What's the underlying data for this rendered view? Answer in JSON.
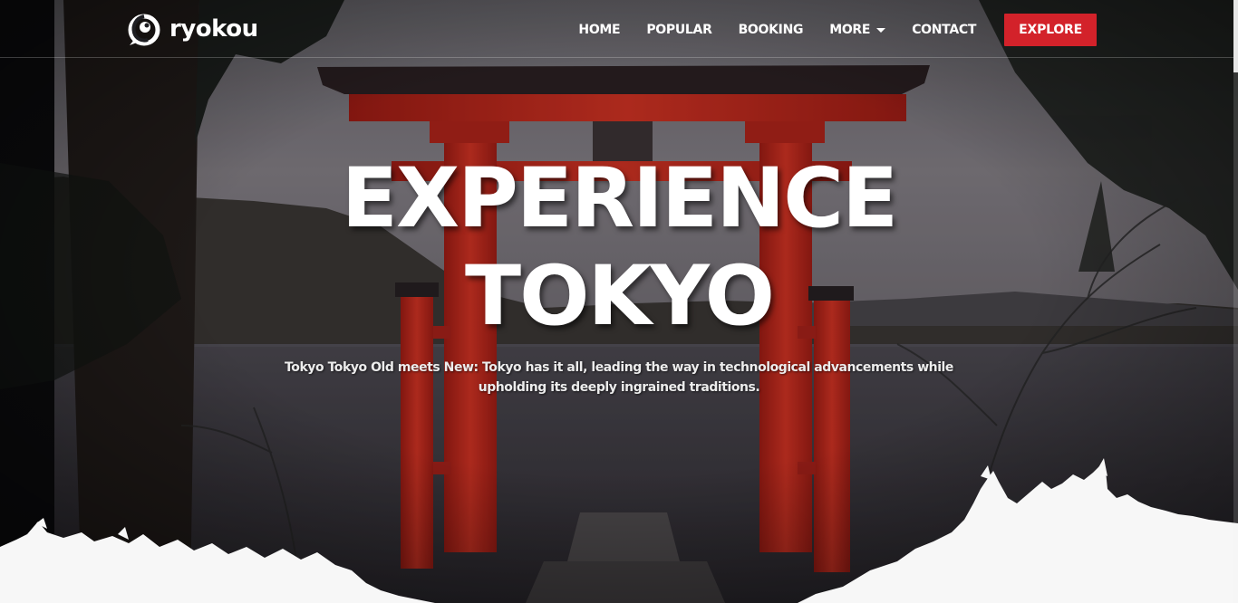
{
  "brand": {
    "name": "ryokou",
    "icon": "swirl-logo-icon"
  },
  "nav": {
    "items": [
      {
        "label": "HOME",
        "name": "nav-home"
      },
      {
        "label": "POPULAR",
        "name": "nav-popular"
      },
      {
        "label": "BOOKING",
        "name": "nav-booking"
      },
      {
        "label": "MORE",
        "name": "nav-more",
        "icon": "caret-down-icon"
      },
      {
        "label": "CONTACT",
        "name": "nav-contact"
      }
    ],
    "cta_label": "EXPLORE"
  },
  "hero": {
    "title_line1": "EXPERIENCE",
    "title_line2": "TOKYO",
    "subtitle": "Tokyo Tokyo Old meets New: Tokyo has it all, leading the way in technological advancements while upholding its deeply ingrained traditions."
  },
  "colors": {
    "accent": "#d3222a",
    "torii": "#c8281d",
    "text": "#ffffff"
  }
}
